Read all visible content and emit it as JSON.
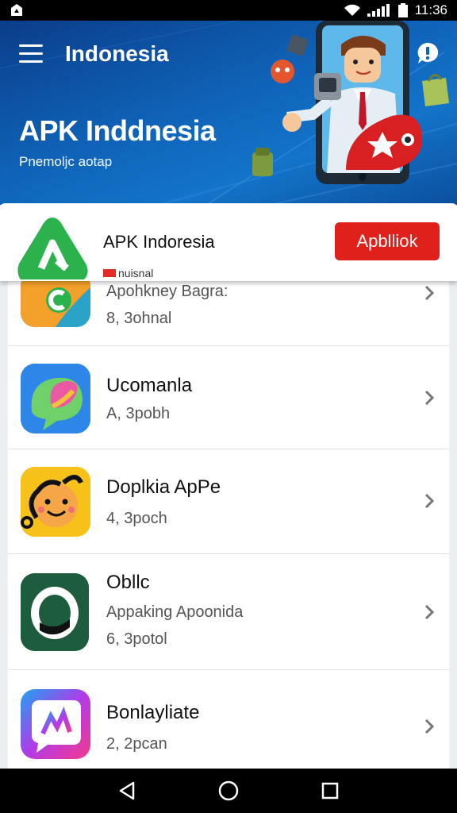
{
  "status_bar": {
    "time": "11:36"
  },
  "header": {
    "title": "Indonesia",
    "hero_title": "APK Inddnesia",
    "hero_subtitle": "Pnemoljс aotap"
  },
  "featured": {
    "name": "APK Indoresia",
    "subtitle": "nuisnal",
    "install_label": "Apblliok"
  },
  "apps": [
    {
      "name": "",
      "line": "Apohkney Bagra:",
      "meta": "8, 3ohnal"
    },
    {
      "name": "Ucomanla",
      "line": "",
      "meta": "A, 3роbh"
    },
    {
      "name": "Doplkia ApPe",
      "line": "",
      "meta": "4, 3рoch"
    },
    {
      "name": "Obllc",
      "line": "Appaking Apoonida",
      "meta": "6, 3potol"
    },
    {
      "name": "Bonlayliate",
      "line": "",
      "meta": "2, 2pcan"
    }
  ],
  "colors": {
    "header_blue": "#0f63b8",
    "install_red": "#e0201b",
    "featured_green": "#2bb24c"
  },
  "icons": {
    "menu": "menu-icon",
    "help": "help-bubble-icon",
    "back": "back-triangle-icon",
    "home": "home-circle-icon",
    "recents": "recents-square-icon"
  }
}
